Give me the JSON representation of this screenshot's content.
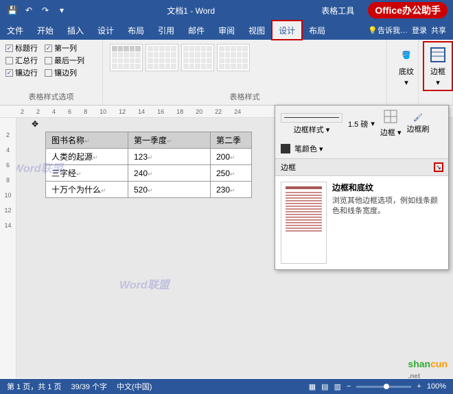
{
  "title": "文档1 - Word",
  "table_tools": "表格工具",
  "brand": {
    "first": "Office",
    "rest": "办公助手"
  },
  "tabs": {
    "file": "文件",
    "home": "开始",
    "insert": "插入",
    "design": "设计",
    "layout": "布局",
    "references": "引用",
    "mailings": "邮件",
    "review": "审阅",
    "view": "视图",
    "design2": "设计",
    "layout2": "布局"
  },
  "right_tabs": {
    "tell": "告诉我…",
    "signin": "登录",
    "share": "共享"
  },
  "ribbon": {
    "options": {
      "header_row": "标题行",
      "first_col": "第一列",
      "total_row": "汇总行",
      "last_col": "最后一列",
      "banded_row": "镶边行",
      "banded_col": "镶边列",
      "group_label": "表格样式选项"
    },
    "styles_label": "表格样式",
    "shading": "底纹",
    "borders": "边框"
  },
  "ruler_h": [
    "2",
    "",
    "2",
    "4",
    "6",
    "8",
    "10",
    "12",
    "14",
    "16",
    "18",
    "20",
    "22",
    "24"
  ],
  "ruler_v": [
    "",
    "",
    "2",
    "",
    "4",
    "",
    "6",
    "",
    "8",
    "",
    "10",
    "",
    "12",
    "",
    "14"
  ],
  "table": {
    "headers": [
      "图书名称",
      "第一季度",
      "第二季"
    ],
    "rows": [
      [
        "人类的起源",
        "123",
        "200"
      ],
      [
        "三字经",
        "240",
        "250"
      ],
      [
        "十万个为什么",
        "520",
        "230"
      ]
    ]
  },
  "popup": {
    "border_style": "边框样式",
    "weight": "1.5 磅",
    "pen_color": "笔颜色",
    "border_btn": "边框",
    "brush_btn": "边框刷",
    "section": "边框",
    "tooltip_title": "边框和底纹",
    "tooltip_text": "浏览其他边框选项，例如线条颜色和线条宽度。"
  },
  "status": {
    "page": "第 1 页，共 1 页",
    "words": "39/39 个字",
    "lang": "中文(中国)",
    "zoom": "100%"
  },
  "shancun": {
    "g": "shan",
    "o": "cun",
    "net": ".net"
  }
}
